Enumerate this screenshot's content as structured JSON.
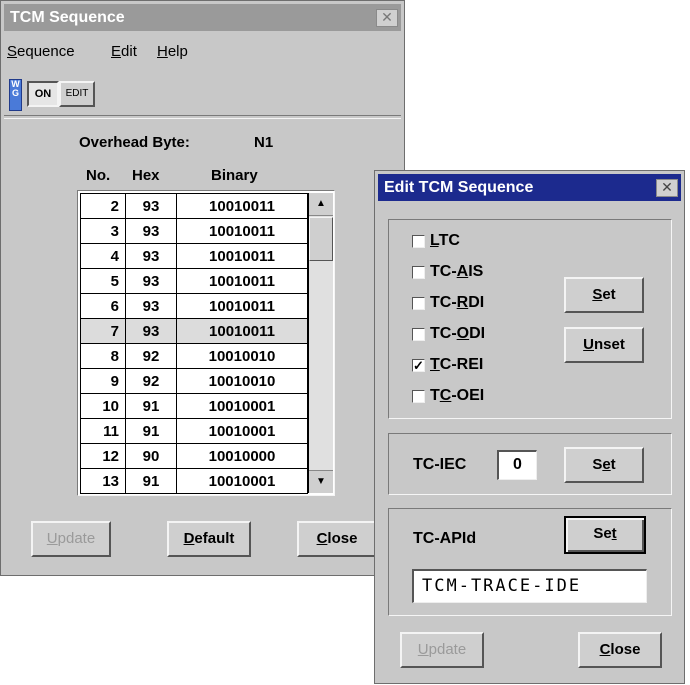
{
  "main_window": {
    "title": "TCM Sequence",
    "menu": [
      {
        "label": "Sequence",
        "underline": "S"
      },
      {
        "label": "Edit",
        "underline": "E"
      },
      {
        "label": "Help",
        "underline": "H"
      }
    ],
    "toolbar": {
      "on_label": "ON",
      "edit_label": "EDIT"
    },
    "overhead_label": "Overhead Byte:",
    "overhead_value": "N1",
    "columns": [
      "No.",
      "Hex",
      "Binary"
    ],
    "rows": [
      {
        "no": "2",
        "hex": "93",
        "bin": "10010011"
      },
      {
        "no": "3",
        "hex": "93",
        "bin": "10010011"
      },
      {
        "no": "4",
        "hex": "93",
        "bin": "10010011"
      },
      {
        "no": "5",
        "hex": "93",
        "bin": "10010011"
      },
      {
        "no": "6",
        "hex": "93",
        "bin": "10010011"
      },
      {
        "no": "7",
        "hex": "93",
        "bin": "10010011"
      },
      {
        "no": "8",
        "hex": "92",
        "bin": "10010010"
      },
      {
        "no": "9",
        "hex": "92",
        "bin": "10010010"
      },
      {
        "no": "10",
        "hex": "91",
        "bin": "10010001"
      },
      {
        "no": "11",
        "hex": "91",
        "bin": "10010001"
      },
      {
        "no": "12",
        "hex": "90",
        "bin": "10010000"
      },
      {
        "no": "13",
        "hex": "91",
        "bin": "10010001"
      }
    ],
    "selected_row": "7",
    "buttons": {
      "update": "Update",
      "default": "Default",
      "close": "Close"
    }
  },
  "dialog": {
    "title": "Edit TCM Sequence",
    "checkboxes": [
      {
        "label": "LTC",
        "checked": false
      },
      {
        "label": "TC-AIS",
        "checked": false
      },
      {
        "label": "TC-RDI",
        "checked": false
      },
      {
        "label": "TC-ODI",
        "checked": false
      },
      {
        "label": "TC-REI",
        "checked": true
      },
      {
        "label": "TC-OEI",
        "checked": false
      }
    ],
    "set_label": "Set",
    "unset_label": "Unset",
    "iec_label": "TC-IEC",
    "iec_value": "0",
    "iec_set_label": "Set",
    "apid_label": "TC-APId",
    "apid_set_label": "Set",
    "apid_value": "TCM-TRACE-IDE",
    "update_label": "Update",
    "close_label": "Close"
  },
  "colors": {
    "titlebar_active": "#1c2a8e",
    "titlebar_inactive": "#9a9a9a",
    "window_bg": "#c8c8c8"
  }
}
